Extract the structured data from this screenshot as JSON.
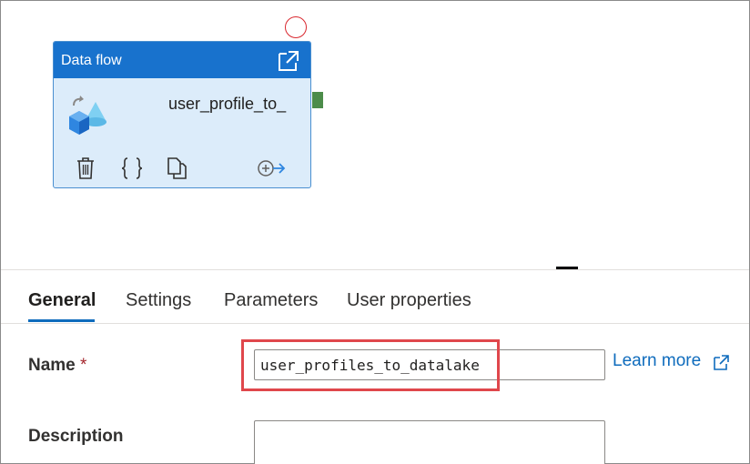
{
  "canvas": {
    "activity": {
      "type_label": "Data flow",
      "name": "user_profile_to_",
      "icons": {
        "open": "open-external-icon",
        "type": "data-flow-icon",
        "delete": "trash-icon",
        "code": "braces-icon",
        "copy": "copy-icon",
        "connect": "add-connection-icon"
      },
      "status": "error",
      "port_color": "#4c8c4a",
      "header_color": "#1872cd",
      "body_color": "#dcecfa"
    }
  },
  "tabs": [
    {
      "label": "General",
      "active": true
    },
    {
      "label": "Settings",
      "active": false
    },
    {
      "label": "Parameters",
      "active": false
    },
    {
      "label": "User properties",
      "active": false
    }
  ],
  "form": {
    "name": {
      "label": "Name",
      "required_mark": "*",
      "value": "user_profiles_to_datalake"
    },
    "learn_more": {
      "label": "Learn more",
      "icon": "open-external-icon"
    },
    "description": {
      "label": "Description",
      "value": ""
    }
  },
  "colors": {
    "accent": "#0f6cbd",
    "highlight": "#e0474c",
    "required": "#a4262c"
  }
}
